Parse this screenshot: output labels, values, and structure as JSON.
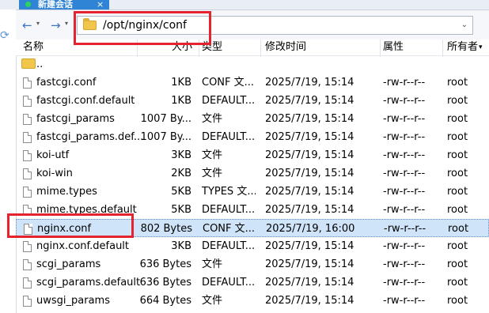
{
  "tab": {
    "title": "新建会话",
    "close": "×"
  },
  "toolbar": {
    "back": "←",
    "forward": "→",
    "caret": "▾",
    "path": "/opt/nginx/conf",
    "dropdown": "⌄"
  },
  "columns": {
    "name": "名称",
    "size": "大小",
    "type": "类型",
    "modified": "修改时间",
    "attributes": "属性",
    "owner": "所有者"
  },
  "colors": {
    "highlight": "#e5232e",
    "selected_row": "#cfe4f8",
    "tab": "#2f84d6"
  },
  "up_dir": {
    "name": ".."
  },
  "rows": [
    {
      "name": "fastcgi.conf",
      "size": "1KB",
      "type": "CONF 文...",
      "modified": "2025/7/19, 15:14",
      "perm": "-rw-r--r--",
      "owner": "root"
    },
    {
      "name": "fastcgi.conf.default",
      "size": "1KB",
      "type": "DEFAULT...",
      "modified": "2025/7/19, 15:14",
      "perm": "-rw-r--r--",
      "owner": "root"
    },
    {
      "name": "fastcgi_params",
      "size": "1007 By...",
      "type": "文件",
      "modified": "2025/7/19, 15:14",
      "perm": "-rw-r--r--",
      "owner": "root"
    },
    {
      "name": "fastcgi_params.def...",
      "size": "1007 By...",
      "type": "DEFAULT...",
      "modified": "2025/7/19, 15:14",
      "perm": "-rw-r--r--",
      "owner": "root"
    },
    {
      "name": "koi-utf",
      "size": "3KB",
      "type": "文件",
      "modified": "2025/7/19, 15:14",
      "perm": "-rw-r--r--",
      "owner": "root"
    },
    {
      "name": "koi-win",
      "size": "2KB",
      "type": "文件",
      "modified": "2025/7/19, 15:14",
      "perm": "-rw-r--r--",
      "owner": "root"
    },
    {
      "name": "mime.types",
      "size": "5KB",
      "type": "TYPES 文...",
      "modified": "2025/7/19, 15:14",
      "perm": "-rw-r--r--",
      "owner": "root"
    },
    {
      "name": "mime.types.default",
      "size": "5KB",
      "type": "DEFAULT...",
      "modified": "2025/7/19, 15:14",
      "perm": "-rw-r--r--",
      "owner": "root"
    },
    {
      "name": "nginx.conf",
      "size": "802 Bytes",
      "type": "CONF 文...",
      "modified": "2025/7/19, 16:00",
      "perm": "-rw-r--r--",
      "owner": "root"
    },
    {
      "name": "nginx.conf.default",
      "size": "3KB",
      "type": "DEFAULT...",
      "modified": "2025/7/19, 15:14",
      "perm": "-rw-r--r--",
      "owner": "root"
    },
    {
      "name": "scgi_params",
      "size": "636 Bytes",
      "type": "文件",
      "modified": "2025/7/19, 15:14",
      "perm": "-rw-r--r--",
      "owner": "root"
    },
    {
      "name": "scgi_params.default",
      "size": "636 Bytes",
      "type": "DEFAULT...",
      "modified": "2025/7/19, 15:14",
      "perm": "-rw-r--r--",
      "owner": "root"
    },
    {
      "name": "uwsgi_params",
      "size": "664 Bytes",
      "type": "文件",
      "modified": "2025/7/19, 15:14",
      "perm": "-rw-r--r--",
      "owner": "root"
    }
  ]
}
